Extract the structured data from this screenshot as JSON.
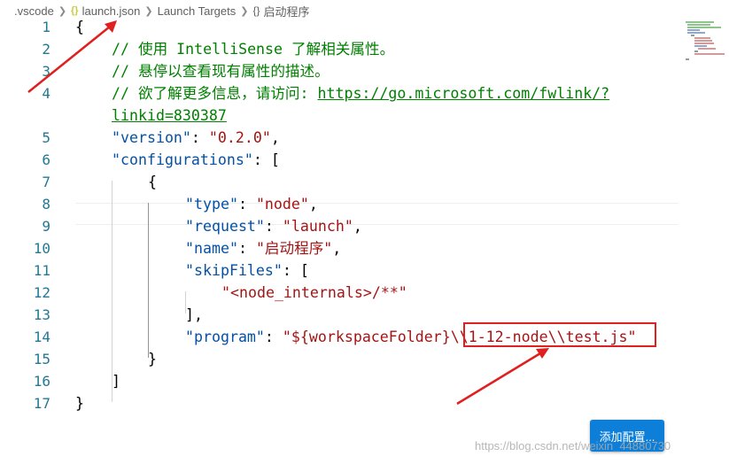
{
  "breadcrumb": {
    "folder": ".vscode",
    "json_icon": "{}",
    "file": "launch.json",
    "section": "Launch Targets",
    "obj_icon": "{}",
    "current": "启动程序"
  },
  "editor": {
    "lines": [
      {
        "num": "1"
      },
      {
        "num": "2",
        "text": "// 使用 IntelliSense 了解相关属性。"
      },
      {
        "num": "3",
        "text": "// 悬停以查看现有属性的描述。"
      },
      {
        "num": "4",
        "prefix": "// 欲了解更多信息，请访问: ",
        "link": "https://go.microsoft.com/fwlink/?"
      },
      {
        "num": "",
        "link": "linkid=830387"
      },
      {
        "num": "5",
        "key": "\"version\"",
        "value": "\"0.2.0\""
      },
      {
        "num": "6",
        "key": "\"configurations\""
      },
      {
        "num": "7"
      },
      {
        "num": "8",
        "key": "\"type\"",
        "value": "\"node\""
      },
      {
        "num": "9",
        "key": "\"request\"",
        "value": "\"launch\""
      },
      {
        "num": "10",
        "key": "\"name\"",
        "value": "\"启动程序\""
      },
      {
        "num": "11",
        "key": "\"skipFiles\""
      },
      {
        "num": "12",
        "value": "\"<node_internals>/**\""
      },
      {
        "num": "13"
      },
      {
        "num": "14",
        "key": "\"program\"",
        "value": "\"${workspaceFolder}\\\\1-12-node\\\\test.js\""
      },
      {
        "num": "15"
      },
      {
        "num": "16"
      },
      {
        "num": "17"
      }
    ]
  },
  "button": {
    "label": "添加配置..."
  },
  "watermark": "https://blog.csdn.net/weixin_44880730",
  "colors": {
    "annotation": "#e0201f",
    "button": "#0e7fd8",
    "line_number": "#237893",
    "comment": "#008000",
    "key": "#0451a5",
    "string": "#a31515"
  }
}
